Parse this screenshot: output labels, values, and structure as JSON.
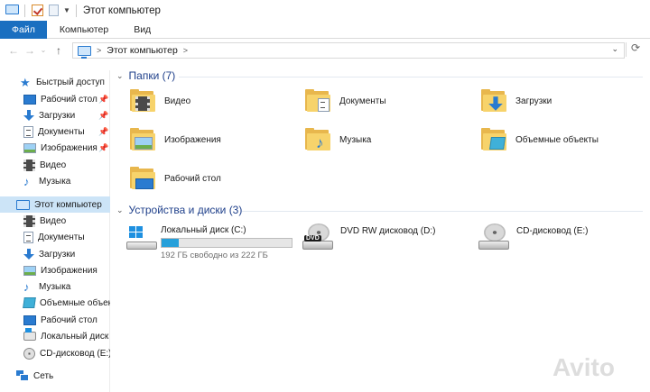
{
  "window": {
    "title": "Этот компьютер"
  },
  "ribbon": {
    "tabs": [
      "Файл",
      "Компьютер",
      "Вид"
    ]
  },
  "address": {
    "crumb": "Этот компьютер"
  },
  "sidebar": {
    "quick_access": "Быстрый доступ",
    "quick_items": [
      {
        "label": "Рабочий стол",
        "icon": "desktop-icon",
        "pinned": true
      },
      {
        "label": "Загрузки",
        "icon": "downloads-icon",
        "pinned": true
      },
      {
        "label": "Документы",
        "icon": "documents-icon",
        "pinned": true
      },
      {
        "label": "Изображения",
        "icon": "pictures-icon",
        "pinned": true
      },
      {
        "label": "Видео",
        "icon": "video-icon",
        "pinned": false
      },
      {
        "label": "Музыка",
        "icon": "music-icon",
        "pinned": false
      }
    ],
    "this_pc": "Этот компьютер",
    "pc_items": [
      {
        "label": "Видео",
        "icon": "video-icon"
      },
      {
        "label": "Документы",
        "icon": "documents-icon"
      },
      {
        "label": "Загрузки",
        "icon": "downloads-icon"
      },
      {
        "label": "Изображения",
        "icon": "pictures-icon"
      },
      {
        "label": "Музыка",
        "icon": "music-icon"
      },
      {
        "label": "Объемные объекты",
        "icon": "3d-objects-icon"
      },
      {
        "label": "Рабочий стол",
        "icon": "desktop-icon"
      },
      {
        "label": "Локальный диск (C:)",
        "icon": "local-disk-icon"
      },
      {
        "label": "CD-дисковод (E:)",
        "icon": "cd-drive-icon"
      }
    ],
    "network": "Сеть"
  },
  "folders": {
    "header": "Папки (7)",
    "items": [
      {
        "label": "Видео",
        "overlay": "video"
      },
      {
        "label": "Документы",
        "overlay": "documents"
      },
      {
        "label": "Загрузки",
        "overlay": "downloads"
      },
      {
        "label": "Изображения",
        "overlay": "pictures"
      },
      {
        "label": "Музыка",
        "overlay": "music"
      },
      {
        "label": "Объемные объекты",
        "overlay": "3d-objects"
      },
      {
        "label": "Рабочий стол",
        "overlay": "desktop"
      }
    ]
  },
  "devices": {
    "header": "Устройства и диски (3)",
    "local_disk": {
      "name": "Локальный диск (C:)",
      "free_text": "192 ГБ свободно из 222 ГБ",
      "used_fraction": 0.135
    },
    "dvd": {
      "name": "DVD RW дисковод (D:)",
      "badge": "DVD"
    },
    "cd": {
      "name": "CD-дисковод (E:)"
    }
  },
  "watermark": "Avito",
  "colors": {
    "accent": "#1a6fc0",
    "selection": "#cce4f7",
    "group_header": "#1e3f8a",
    "disk_bar": "#26a0da"
  }
}
